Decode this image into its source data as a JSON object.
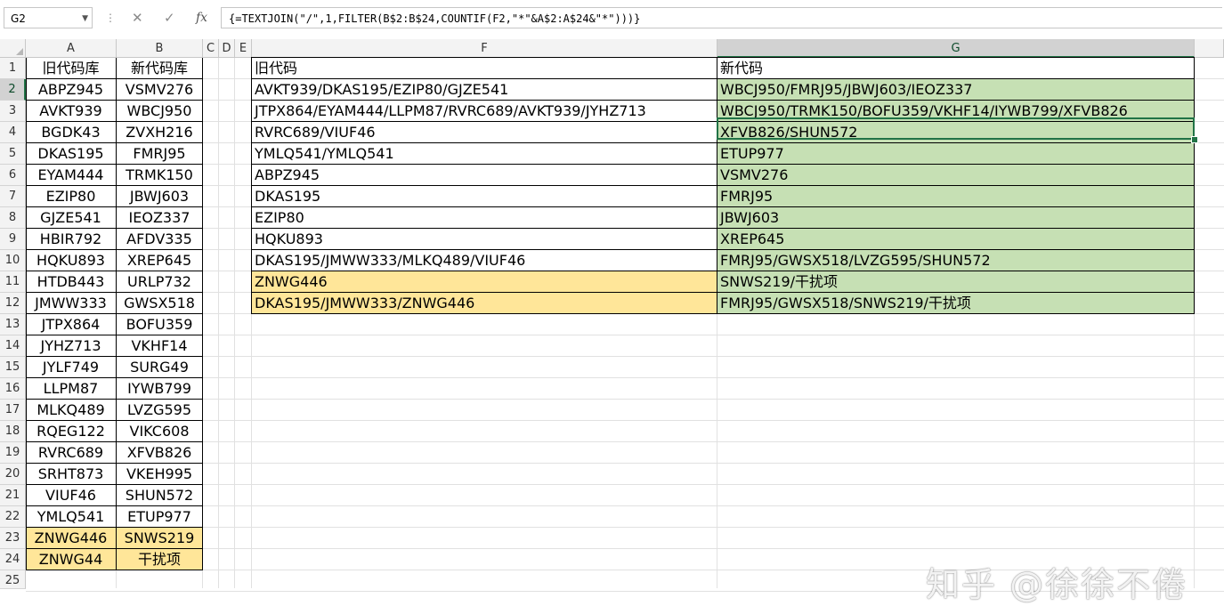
{
  "formula_bar": {
    "name_box": "G2",
    "cancel_glyph": "✕",
    "confirm_glyph": "✓",
    "fx_label": "fx",
    "formula": "{=TEXTJOIN(\"/\",1,FILTER(B$2:B$24,COUNTIF(F2,\"*\"&A$2:A$24&\"*\")))}"
  },
  "columns": [
    "A",
    "B",
    "C",
    "D",
    "E",
    "F",
    "G"
  ],
  "rows": [
    "1",
    "2",
    "3",
    "4",
    "5",
    "6",
    "7",
    "8",
    "9",
    "10",
    "11",
    "12",
    "13",
    "14",
    "15",
    "16",
    "17",
    "18",
    "19",
    "20",
    "21",
    "22",
    "23",
    "24",
    "25"
  ],
  "selected_cell": "G2",
  "colors": {
    "highlight_yellow": "#ffe699",
    "result_green": "#c6e0b4",
    "selection": "#217346"
  },
  "table_ab": {
    "header": [
      "旧代码库",
      "新代码库"
    ],
    "rows": [
      [
        "ABPZ945",
        "VSMV276"
      ],
      [
        "AVKT939",
        "WBCJ950"
      ],
      [
        "BGDK43",
        "ZVXH216"
      ],
      [
        "DKAS195",
        "FMRJ95"
      ],
      [
        "EYAM444",
        "TRMK150"
      ],
      [
        "EZIP80",
        "JBWJ603"
      ],
      [
        "GJZE541",
        "IEOZ337"
      ],
      [
        "HBIR792",
        "AFDV335"
      ],
      [
        "HQKU893",
        "XREP645"
      ],
      [
        "HTDB443",
        "URLP732"
      ],
      [
        "JMWW333",
        "GWSX518"
      ],
      [
        "JTPX864",
        "BOFU359"
      ],
      [
        "JYHZ713",
        "VKHF14"
      ],
      [
        "JYLF749",
        "SURG49"
      ],
      [
        "LLPM87",
        "IYWB799"
      ],
      [
        "MLKQ489",
        "LVZG595"
      ],
      [
        "RQEG122",
        "VIKC608"
      ],
      [
        "RVRC689",
        "XFVB826"
      ],
      [
        "SRHT873",
        "VKEH995"
      ],
      [
        "VIUF46",
        "SHUN572"
      ],
      [
        "YMLQ541",
        "ETUP977"
      ],
      [
        "ZNWG446",
        "SNWS219"
      ],
      [
        "ZNWG44",
        "干扰项"
      ]
    ],
    "highlighted_rows": [
      21,
      22
    ]
  },
  "table_fg": {
    "header": [
      "旧代码",
      "新代码"
    ],
    "rows": [
      [
        "AVKT939/DKAS195/EZIP80/GJZE541",
        "WBCJ950/FMRJ95/JBWJ603/IEOZ337"
      ],
      [
        "JTPX864/EYAM444/LLPM87/RVRC689/AVKT939/JYHZ713",
        "WBCJ950/TRMK150/BOFU359/VKHF14/IYWB799/XFVB826"
      ],
      [
        "RVRC689/VIUF46",
        "XFVB826/SHUN572"
      ],
      [
        "YMLQ541/YMLQ541",
        "ETUP977"
      ],
      [
        "ABPZ945",
        "VSMV276"
      ],
      [
        "DKAS195",
        "FMRJ95"
      ],
      [
        "EZIP80",
        "JBWJ603"
      ],
      [
        "HQKU893",
        "XREP645"
      ],
      [
        "DKAS195/JMWW333/MLKQ489/VIUF46",
        "FMRJ95/GWSX518/LVZG595/SHUN572"
      ],
      [
        "ZNWG446",
        "SNWS219/干扰项"
      ],
      [
        "DKAS195/JMWW333/ZNWG446",
        "FMRJ95/GWSX518/SNWS219/干扰项"
      ]
    ],
    "highlighted_rows": [
      9,
      10
    ]
  },
  "watermark": "知乎 @徐徐不倦"
}
